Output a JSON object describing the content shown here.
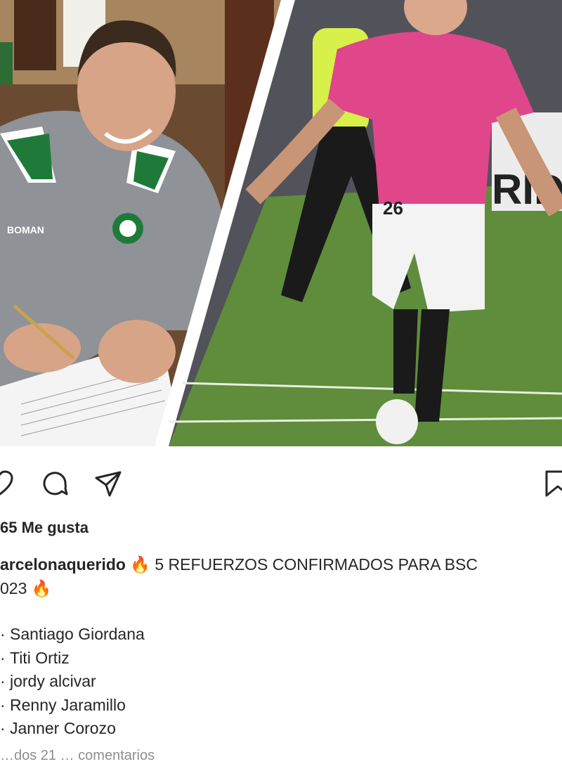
{
  "post": {
    "image": {
      "left_photo": "player-signing-contract",
      "right_photo": "player-celebrating-goal",
      "jacket_brand": "BOMAN",
      "jersey_number": "26"
    },
    "actions": {
      "like_icon": "heart-icon",
      "comment_icon": "comment-icon",
      "share_icon": "send-icon",
      "save_icon": "bookmark-icon"
    },
    "likes_text": "65 Me gusta",
    "caption": {
      "username": "arcelonaquerido",
      "fire_emoji": "🔥",
      "text_line1": "5 REFUERZOS CONFIRMADOS PARA BSC",
      "text_line2_start": "023",
      "players": [
        "Santiago Giordana",
        "Titi Ortiz",
        "jordy alcivar",
        "Renny Jaramillo",
        "Janner Corozo"
      ],
      "bullet": "·"
    },
    "footer_text": "…dos 21 … comentarios"
  },
  "colors": {
    "text": "#262626",
    "muted": "#8e8e8e",
    "jacket_gray": "#8f9297",
    "jacket_green": "#1f7a3a",
    "jersey_pink": "#e0468a",
    "pitch_green": "#5f8d3c"
  }
}
